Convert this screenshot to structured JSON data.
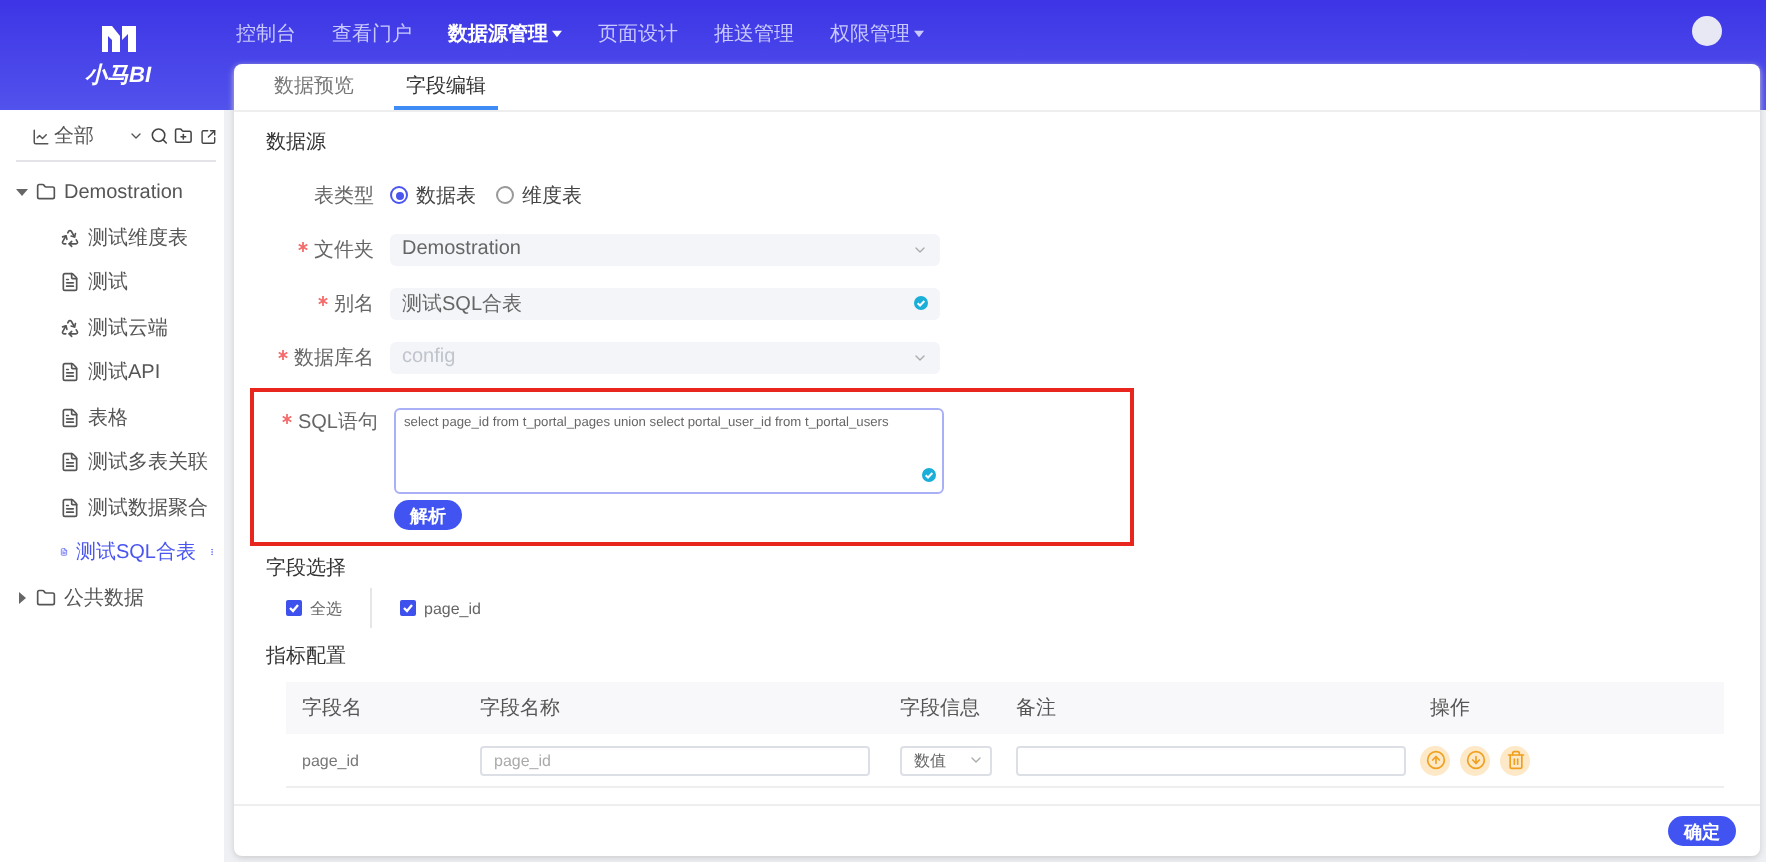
{
  "brand": {
    "name": "小马BI"
  },
  "nav": [
    {
      "label": "控制台",
      "selected": false,
      "dropdown": false
    },
    {
      "label": "查看门户",
      "selected": false,
      "dropdown": false
    },
    {
      "label": "数据源管理",
      "selected": true,
      "dropdown": true
    },
    {
      "label": "页面设计",
      "selected": false,
      "dropdown": false
    },
    {
      "label": "推送管理",
      "selected": false,
      "dropdown": false
    },
    {
      "label": "权限管理",
      "selected": false,
      "dropdown": true
    }
  ],
  "sidebar": {
    "filter": "全部",
    "tree": [
      {
        "label": "Demostration",
        "expanded": true,
        "children": [
          {
            "label": "测试维度表",
            "kind": "dimension",
            "selected": false
          },
          {
            "label": "测试",
            "kind": "table",
            "selected": false
          },
          {
            "label": "测试云端",
            "kind": "dimension",
            "selected": false
          },
          {
            "label": "测试API",
            "kind": "table",
            "selected": false
          },
          {
            "label": "表格",
            "kind": "table",
            "selected": false
          },
          {
            "label": "测试多表关联",
            "kind": "table",
            "selected": false
          },
          {
            "label": "测试数据聚合",
            "kind": "table",
            "selected": false
          },
          {
            "label": "测试SQL合表",
            "kind": "table",
            "selected": true
          }
        ]
      },
      {
        "label": "公共数据",
        "expanded": false
      }
    ]
  },
  "tabs": [
    {
      "label": "数据预览",
      "selected": false
    },
    {
      "label": "字段编辑",
      "selected": true
    }
  ],
  "form": {
    "section": "数据源",
    "fields": [
      {
        "kind": "radio",
        "label": "表类型",
        "required": false,
        "options": [
          {
            "label": "数据表",
            "selected": true
          },
          {
            "label": "维度表",
            "selected": false
          }
        ]
      },
      {
        "kind": "select",
        "label": "文件夹",
        "required": true,
        "value": "Demostration",
        "disabled": false
      },
      {
        "kind": "input",
        "label": "别名",
        "required": true,
        "value": "测试SQL合表",
        "valid": true
      },
      {
        "kind": "select",
        "label": "数据库名",
        "required": true,
        "placeholder": "config",
        "disabled": true
      }
    ],
    "sql": {
      "label": "SQL语句",
      "required": true,
      "value": "select page_id from t_portal_pages union select portal_user_id from t_portal_users",
      "valid": true,
      "highlighted": true,
      "button": "解析"
    }
  },
  "field_selection": {
    "title": "字段选择",
    "options": [
      {
        "label": "全选",
        "checked": true
      },
      {
        "label": "page_id",
        "checked": true
      }
    ]
  },
  "metrics": {
    "title": "指标配置",
    "columns": [
      "字段名",
      "字段名称",
      "字段信息",
      "备注",
      "操作"
    ],
    "rows": [
      {
        "field": "page_id",
        "name_placeholder": "page_id",
        "type": "数值",
        "actions": [
          {
            "kind": "up"
          },
          {
            "kind": "down"
          },
          {
            "kind": "delete"
          }
        ]
      }
    ]
  },
  "footer": {
    "confirm": "确定"
  }
}
